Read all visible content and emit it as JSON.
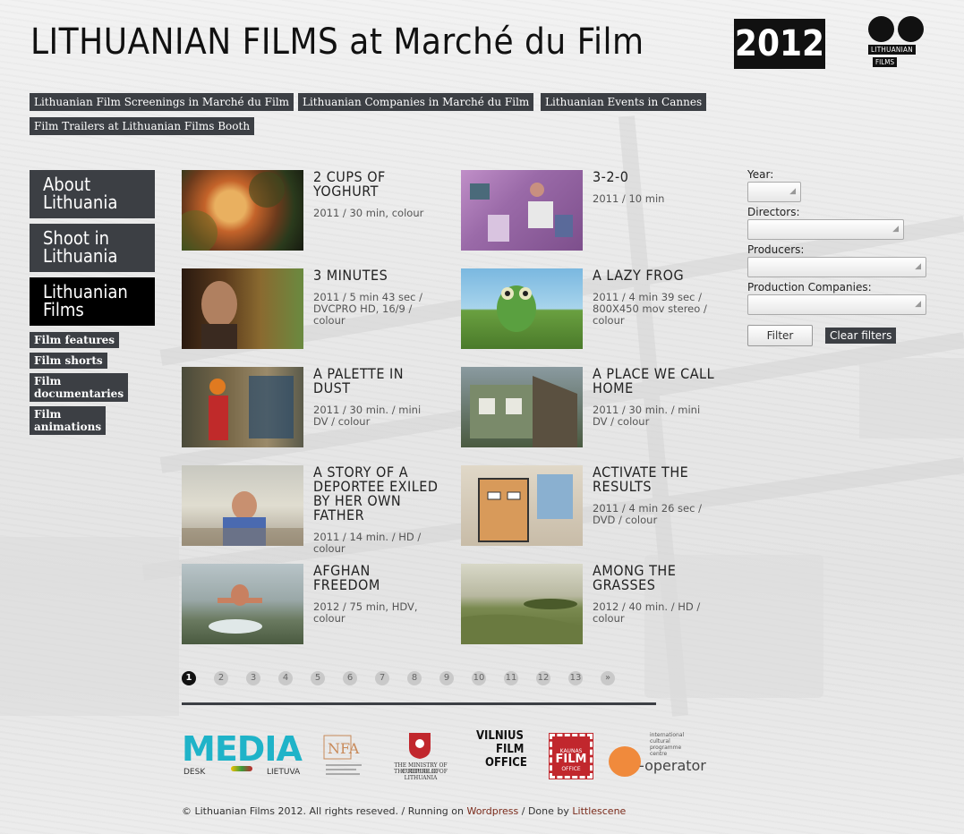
{
  "header": {
    "title": "LITHUANIAN FILMS at Marché du Film",
    "year": "2012",
    "logo_line1": "LITHUANIAN",
    "logo_line2": "FILMS"
  },
  "top_nav": [
    {
      "label": "Lithuanian Film Screenings in Marché du Film"
    },
    {
      "label": "Lithuanian Companies in Marché du Film"
    },
    {
      "label": "Lithuanian Events in Cannes"
    },
    {
      "label": "Film Trailers at Lithuanian Films Booth"
    }
  ],
  "sidebar": {
    "main": [
      {
        "label_1": "About",
        "label_2": "Lithuania"
      },
      {
        "label_1": "Shoot in",
        "label_2": "Lithuania"
      },
      {
        "label_1": "Lithuanian",
        "label_2": "Films"
      }
    ],
    "sub": [
      {
        "label_1": "Film features",
        "label_2": ""
      },
      {
        "label_1": "Film shorts",
        "label_2": ""
      },
      {
        "label_1": "Film",
        "label_2": "documentaries"
      },
      {
        "label_1": "Film",
        "label_2": "animations"
      }
    ]
  },
  "films": [
    {
      "title": "2 CUPS OF YOGHURT",
      "meta": "2011 / 30 min, colour"
    },
    {
      "title": "3-2-0",
      "meta": "2011 / 10 min"
    },
    {
      "title": "3 MINUTES",
      "meta": "2011 / 5 min 43 sec / DVCPRO HD, 16/9 / colour"
    },
    {
      "title": "A LAZY FROG",
      "meta": "2011 / 4 min 39 sec / 800X450 mov stereo / colour"
    },
    {
      "title": "A PALETTE IN DUST",
      "meta": "2011 / 30 min. / mini DV / colour"
    },
    {
      "title": "A PLACE WE CALL HOME",
      "meta": "2011 / 30 min. / mini DV / colour"
    },
    {
      "title": "A STORY OF A DEPORTEE EXILED BY HER OWN FATHER",
      "meta": "2011 / 14 min. / HD / colour"
    },
    {
      "title": "ACTIVATE THE RESULTS",
      "meta": "2011 / 4 min 26 sec / DVD / colour"
    },
    {
      "title": "AFGHAN FREEDOM",
      "meta": "2012 / 75 min, HDV, colour"
    },
    {
      "title": "AMONG THE GRASSES",
      "meta": "2012 / 40 min. / HD / colour"
    }
  ],
  "filters": {
    "year_label": "Year:",
    "directors_label": "Directors:",
    "producers_label": "Producers:",
    "companies_label": "Production Companies:",
    "filter_button": "Filter",
    "clear_button": "Clear filters"
  },
  "pagination": [
    "1",
    "2",
    "3",
    "4",
    "5",
    "6",
    "7",
    "8",
    "9",
    "10",
    "11",
    "12",
    "13",
    "»"
  ],
  "sponsors": {
    "media_1": "MEDIA",
    "media_desk": "DESK",
    "media_lietuva": "LIETUVA",
    "ministry_1": "THE MINISTRY OF CULTURE OF",
    "ministry_2": "THE REPUBLIC OF LITHUANIA",
    "vilnius_1": "VILNIUS",
    "vilnius_2": "FILM",
    "vilnius_3": "OFFICE",
    "kaunas_1": "KAUNAS",
    "kaunas_2": "FILM",
    "kaunas_3": "OFFICE",
    "ko_small_1": "international",
    "ko_small_2": "cultural",
    "ko_small_3": "programme",
    "ko_small_4": "centre",
    "ko_big": "-operator"
  },
  "footer": {
    "text_1": "© Lithuanian Films 2012. All rights reseved. / Running on",
    "link_1": "Wordpress",
    "text_2": "/ Done by",
    "link_2": "Littlescene"
  },
  "colors": {
    "nav_bg": "#3c3f44",
    "active_bg": "#000000",
    "link": "#7a2a1a",
    "media_cyan": "#1fb3c8",
    "media_green": "#8cc63f",
    "kaunas_red": "#c1272d",
    "ko_orange": "#f08a3c"
  }
}
